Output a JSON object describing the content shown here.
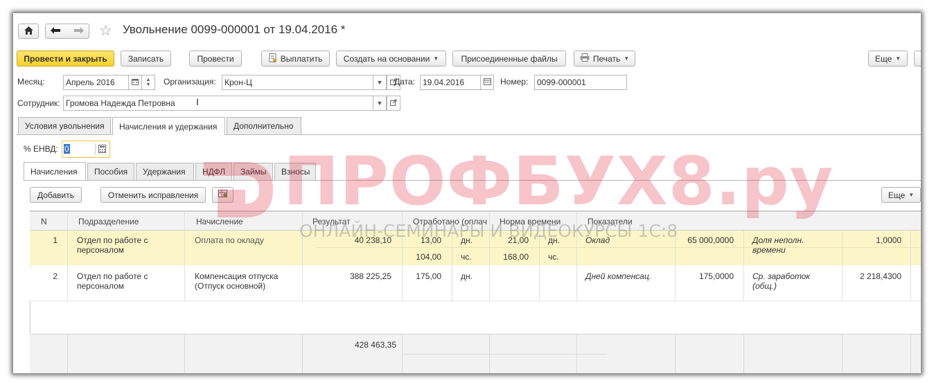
{
  "header": {
    "title": "Увольнение 0099-000001 от 19.04.2016 *"
  },
  "toolbar": {
    "post_close": "Провести и закрыть",
    "save": "Записать",
    "post": "Провести",
    "pay": "Выплатить",
    "create_based": "Создать на основании",
    "attached_files": "Присоединенные файлы",
    "print": "Печать",
    "more": "Еще"
  },
  "form": {
    "month_label": "Месяц:",
    "month_value": "Апрель 2016",
    "org_label": "Организация:",
    "org_value": "Крон-Ц",
    "date_label": "Дата:",
    "date_value": "19.04.2016",
    "number_label": "Номер:",
    "number_value": "0099-000001",
    "employee_label": "Сотрудник:",
    "employee_value": "Громова Надежда Петровна"
  },
  "tabs": [
    "Условия увольнения",
    "Начисления и удержания",
    "Дополнительно"
  ],
  "envd": {
    "label": "% ЕНВД:",
    "value": "0"
  },
  "subtabs": [
    "Начисления",
    "Пособия",
    "Удержания",
    "НДФЛ",
    "Займы",
    "Взносы"
  ],
  "grid_toolbar": {
    "add": "Добавить",
    "cancel_corrections": "Отменить исправления",
    "more": "Еще"
  },
  "grid": {
    "columns": [
      "N",
      "Подразделение",
      "Начисление",
      "Результат",
      "Отработано (оплач",
      "Норма времени",
      "Показатели"
    ],
    "rows": [
      {
        "n": "1",
        "dept": "Отдел по работе с персоналом",
        "accrual": "Оплата по окладу",
        "result": "40 238,10",
        "worked_days": "13,00",
        "worked_days_unit": "дн.",
        "worked_hours": "104,00",
        "worked_hours_unit": "чс.",
        "norm_days": "21,00",
        "norm_days_unit": "дн.",
        "norm_hours": "168,00",
        "norm_hours_unit": "чс.",
        "ind1_name": "Оклад",
        "ind1_value": "65 000,0000",
        "ind2_name": "Доля неполн. времени",
        "ind2_value": "1,0000"
      },
      {
        "n": "2",
        "dept": "Отдел по работе с персоналом",
        "accrual": "Компенсация отпуска (Отпуск основной)",
        "result": "388 225,25",
        "worked_days": "175,00",
        "worked_days_unit": "дн.",
        "ind1_name": "Дней компенсац.",
        "ind1_value": "175,0000",
        "ind2_name": "Ср. заработок (общ.)",
        "ind2_value": "2 218,4300"
      }
    ],
    "total": "428 463,35"
  },
  "watermark": {
    "main": "ПРОФБУХ8.ру",
    "sub": "ОНЛАЙН-СЕМИНАРЫ И ВИДЕОКУРСЫ 1С:8"
  }
}
